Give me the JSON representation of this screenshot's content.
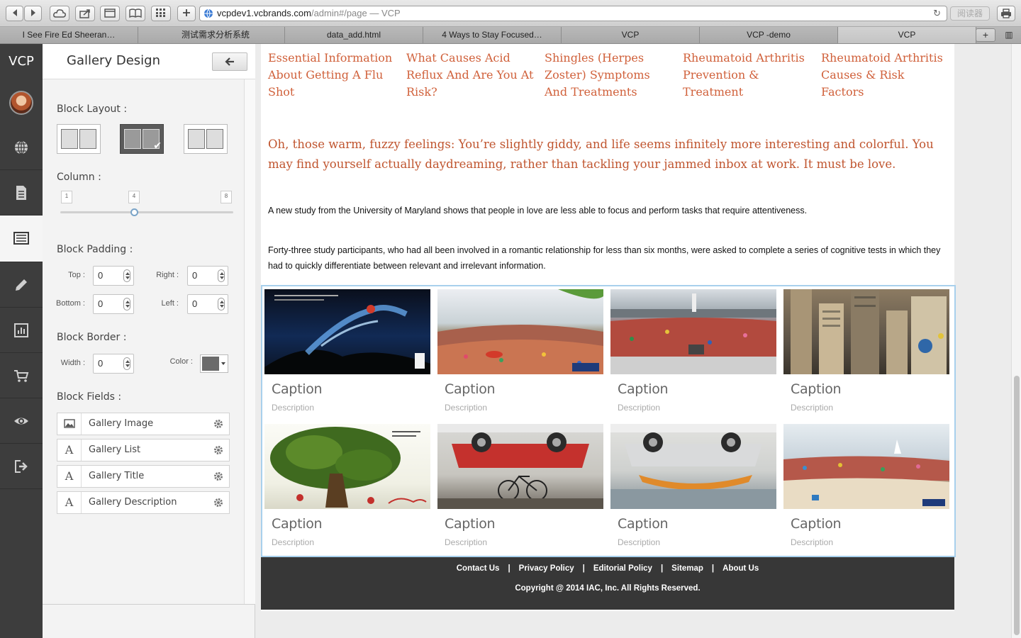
{
  "browser": {
    "url_host": "vcpdev1.vcbrands.com",
    "url_path": "/admin#/page",
    "url_suffix": " — VCP",
    "reader_label": "阅读器",
    "tabs": [
      {
        "label": "I See Fire Ed Sheeran…",
        "active": false
      },
      {
        "label": "测试需求分析系统",
        "active": false
      },
      {
        "label": "data_add.html",
        "active": false
      },
      {
        "label": "4 Ways to Stay Focused…",
        "active": false
      },
      {
        "label": "VCP",
        "active": false
      },
      {
        "label": "VCP -demo",
        "active": false
      },
      {
        "label": "VCP",
        "active": true
      }
    ]
  },
  "rail": {
    "logo": "VCP",
    "items": [
      "globe-icon",
      "page-icon",
      "layout-icon",
      "pencil-icon",
      "chart-icon",
      "cart-icon",
      "eye-icon",
      "logout-icon"
    ],
    "active_item": "layout-icon"
  },
  "panel": {
    "title": "Gallery Design",
    "block_layout_label": "Block Layout :",
    "column_label": "Column :",
    "column_min": "1",
    "column_value": "4",
    "column_max": "8",
    "column_fraction": 0.43,
    "block_padding_label": "Block Padding :",
    "padding": {
      "top_label": "Top :",
      "top": "0",
      "right_label": "Right :",
      "right": "0",
      "bottom_label": "Bottom :",
      "bottom": "0",
      "left_label": "Left :",
      "left": "0"
    },
    "block_border_label": "Block Border :",
    "border": {
      "width_label": "Width :",
      "width": "0",
      "color_label": "Color :",
      "color": "#6b6b6b"
    },
    "block_fields_label": "Block Fields :",
    "fields": [
      {
        "label": "Gallery Image",
        "icon": "image-icon"
      },
      {
        "label": "Gallery List",
        "icon": "text-icon"
      },
      {
        "label": "Gallery Title",
        "icon": "text-icon"
      },
      {
        "label": "Gallery Description",
        "icon": "text-icon"
      }
    ]
  },
  "content": {
    "article_links": [
      "Essential Information About Getting A Flu Shot",
      "What Causes Acid Reflux And Are You At Risk?",
      "Shingles (Herpes Zoster) Symptoms And Treatments",
      "Rheumatoid Arthritis Prevention & Treatment",
      "Rheumatoid Arthritis Causes & Risk Factors"
    ],
    "lead": "Oh, those warm, fuzzy feelings: You’re slightly giddy, and life seems infinitely more interesting and colorful. You may find yourself actually daydreaming, rather than tackling your jammed inbox at work. It must be love.",
    "paragraph_1": "A new study from the University of Maryland shows that people in love are less able to focus and perform tasks that require attentiveness.",
    "paragraph_2": "Forty-three study participants, who had all been involved in a romantic relationship for less than six months, were asked to complete a series of cognitive tests in which they had to quickly differentiate between relevant and irrelevant information.",
    "gallery": [
      {
        "caption": "Caption",
        "description": "Description",
        "scene": "splash-runner"
      },
      {
        "caption": "Caption",
        "description": "Description",
        "scene": "candy-field"
      },
      {
        "caption": "Caption",
        "description": "Description",
        "scene": "candy-stadium"
      },
      {
        "caption": "Caption",
        "description": "Description",
        "scene": "city-climber"
      },
      {
        "caption": "Caption",
        "description": "Description",
        "scene": "tree"
      },
      {
        "caption": "Caption",
        "description": "Description",
        "scene": "car-bike"
      },
      {
        "caption": "Caption",
        "description": "Description",
        "scene": "car-canoe"
      },
      {
        "caption": "Caption",
        "description": "Description",
        "scene": "candy-beach"
      }
    ],
    "footer_links": [
      "Contact Us",
      "Privacy Policy",
      "Editorial Policy",
      "Sitemap",
      "About Us"
    ],
    "footer_separator": "|",
    "copyright": "Copyright @ 2014 IAC, Inc. All Rights Reserved."
  },
  "colors": {
    "accent_link": "#d0603a",
    "lead_text": "#c0552f",
    "rail_bg": "#3d3d3d",
    "footer_bg": "#373737",
    "gallery_border": "#a8d0ec"
  }
}
